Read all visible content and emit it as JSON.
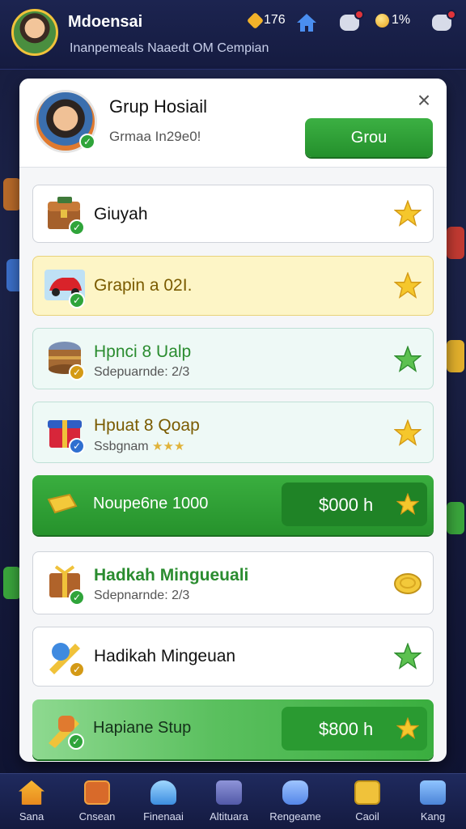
{
  "header": {
    "player_name": "Mdoensai",
    "subtitle": "Inanpemeals Naaedt OM Cempian",
    "gems": "176",
    "coins": "1%"
  },
  "dialog": {
    "title": "Grup Hosiail",
    "subtitle": "Grmaa In29e0!",
    "group_button": "Grou",
    "close_icon": "close-icon",
    "items": [
      {
        "title": "Giuyah",
        "subtitle": "",
        "icon": "chest-icon",
        "reward_icon": "star-icon",
        "style": "white"
      },
      {
        "title": "Grapin a 02I.",
        "subtitle": "",
        "icon": "car-icon",
        "reward_icon": "star-icon",
        "style": "yellow"
      },
      {
        "title": "Hpnci 8 Ualp",
        "subtitle": "Sdepuarnde: 2/3",
        "icon": "barrel-icon",
        "reward_icon": "star-icon",
        "style": "mint"
      },
      {
        "title": "Hpuat 8 Qoap",
        "subtitle": "Ssbgnam",
        "icon": "gift-box-icon",
        "reward_icon": "star-icon",
        "style": "mint"
      }
    ],
    "offer_1": {
      "title": "Noupe6ne 1000",
      "price": "$000 h",
      "icon": "gold-bar-icon"
    },
    "items_2": [
      {
        "title": "Hadkah Mingueuali",
        "subtitle": "Sdepnarnde: 2/3",
        "icon": "gift-chest-icon",
        "reward_icon": "coin-icon"
      },
      {
        "title": "Hadikah Mingeuan",
        "subtitle": "",
        "icon": "rocket-icon",
        "reward_icon": "star-icon"
      }
    ],
    "offer_2": {
      "title": "Hapiane Stup",
      "price": "$800 h",
      "icon": "rocket-icon"
    }
  },
  "nav": [
    {
      "label": "Sana",
      "icon": "home-icon"
    },
    {
      "label": "Cnsean",
      "icon": "shop-icon"
    },
    {
      "label": "Finenaai",
      "icon": "event-icon"
    },
    {
      "label": "Altituara",
      "icon": "layers-icon"
    },
    {
      "label": "Rengeame",
      "icon": "fish-icon"
    },
    {
      "label": "Caoil",
      "icon": "mail-icon"
    },
    {
      "label": "Kang",
      "icon": "list-icon"
    }
  ],
  "colors": {
    "accent_green": "#2fa43a",
    "background": "#151a3b",
    "star_gold": "#f5b721",
    "star_green": "#4cb843"
  }
}
